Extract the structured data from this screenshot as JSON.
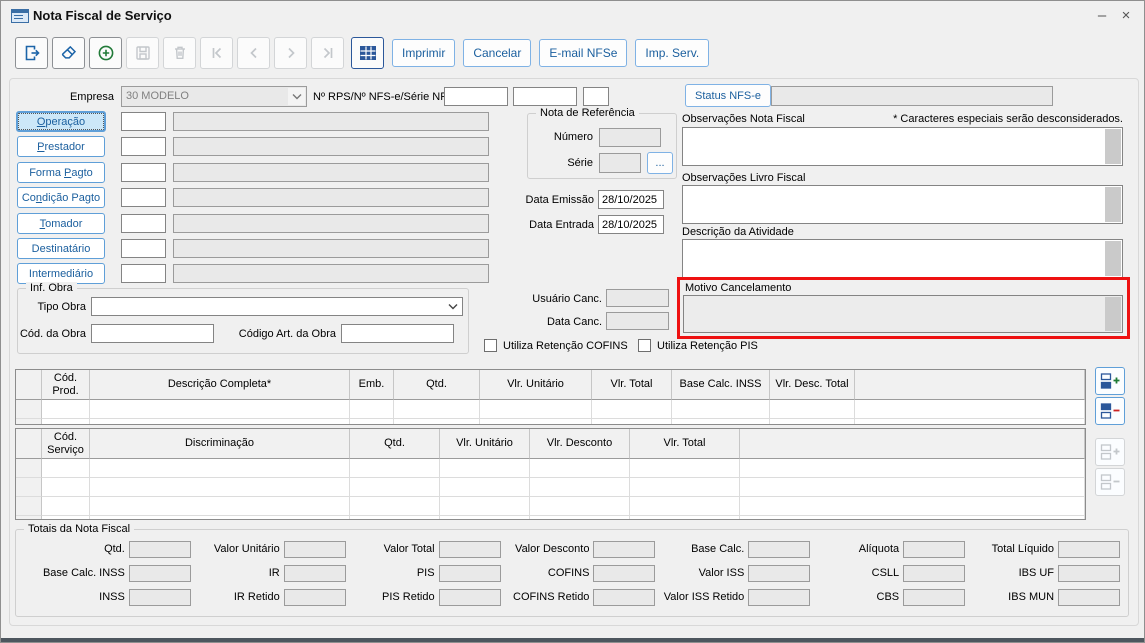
{
  "window": {
    "title": "Nota Fiscal de Serviço"
  },
  "titlebar": {
    "minimize_glyph": "–",
    "close_glyph": "×"
  },
  "icons": {
    "window": "form-window",
    "exit": "door-with-arrow-right",
    "erase": "eraser",
    "new": "plus-circle",
    "save": "floppy-disk",
    "delete": "trash-can",
    "first": "bar-chevron-left",
    "previous": "chevron-left",
    "next": "chevron-right",
    "last": "chevron-right-bar",
    "grid": "data-grid-table",
    "add_row": "grid-rows-plus",
    "remove_row": "grid-rows-minus",
    "dropdown": "chevron-down"
  },
  "toolbar": {
    "text_buttons": [
      "Imprimir",
      "Cancelar",
      "E-mail NFSe",
      "Imp. Serv."
    ]
  },
  "header": {
    "empresa_label": "Empresa",
    "empresa_value": "30 MODELO",
    "rps_label": "Nº RPS/Nº NFS-e/Série NF",
    "status_button_label": "Status NFS-e"
  },
  "nav": {
    "items": [
      {
        "pre": "",
        "key": "O",
        "post": "peração"
      },
      {
        "pre": "",
        "key": "P",
        "post": "restador"
      },
      {
        "pre": "Forma ",
        "key": "P",
        "post": "agto"
      },
      {
        "pre": "Co",
        "key": "n",
        "post": "dição Pagto"
      },
      {
        "pre": "",
        "key": "T",
        "post": "omador"
      },
      {
        "pre": "Destinatário",
        "key": "",
        "post": ""
      },
      {
        "pre": "Intermediário",
        "key": "",
        "post": ""
      }
    ]
  },
  "nota_referencia": {
    "legend": "Nota de Referência",
    "numero_label": "Número",
    "serie_label": "Série",
    "browse_label": "..."
  },
  "datas": {
    "emissao_label": "Data Emissão",
    "emissao_value": "28/10/2025",
    "entrada_label": "Data Entrada",
    "entrada_value": "28/10/2025"
  },
  "cancelamento": {
    "usuario_label": "Usuário Canc.",
    "data_label": "Data Canc.",
    "motivo_label": "Motivo Cancelamento"
  },
  "retencoes": {
    "cofins_label": "Utiliza Retenção COFINS",
    "cofins_checked": false,
    "pis_label": "Utiliza Retenção PIS",
    "pis_checked": false
  },
  "inf_obra": {
    "legend": "Inf. Obra",
    "tipo_obra_label": "Tipo Obra",
    "cod_obra_label": "Cód. da Obra",
    "codigo_art_label": "Código Art. da Obra"
  },
  "observacoes": {
    "nota_fiscal_label": "Observações Nota Fiscal",
    "special_note": "* Caracteres especiais serão desconsiderados.",
    "livro_fiscal_label": "Observações Livro Fiscal",
    "descricao_atividade_label": "Descrição da Atividade"
  },
  "product_table": {
    "headers": [
      "",
      "Cód.\nProd.",
      "Descrição Completa*",
      "Emb.",
      "Qtd.",
      "Vlr. Unitário",
      "Vlr. Total",
      "Base Calc. INSS",
      "Vlr. Desc. Total",
      ""
    ],
    "visible_rows": 2
  },
  "service_table": {
    "headers": [
      "",
      "Cód.\nServiço",
      "Discriminação",
      "Qtd.",
      "Vlr. Unitário",
      "Vlr. Desconto",
      "Vlr. Total",
      ""
    ],
    "visible_rows": 4
  },
  "totais": {
    "legend": "Totais da Nota Fiscal",
    "columns": [
      [
        "Qtd.",
        "Base Calc. INSS",
        "INSS"
      ],
      [
        "Valor Unitário",
        "IR",
        "IR Retido"
      ],
      [
        "Valor Total",
        "PIS",
        "PIS Retido"
      ],
      [
        "Valor Desconto",
        "COFINS",
        "COFINS Retido"
      ],
      [
        "Base Calc.",
        "Valor ISS",
        "Valor ISS Retido"
      ],
      [
        "Alíquota",
        "CSLL",
        "CBS"
      ],
      [
        "Total Líquido",
        "IBS UF",
        "IBS MUN"
      ]
    ]
  },
  "colors": {
    "accent_blue": "#1b5f9e",
    "annotation_red": "#ee1111",
    "add_green": "#1f7a35",
    "remove_red": "#cc2222",
    "grid_blue": "#2b579a",
    "disabled_gray": "#c3c7cb",
    "field_gray": "#e9e9e9"
  }
}
